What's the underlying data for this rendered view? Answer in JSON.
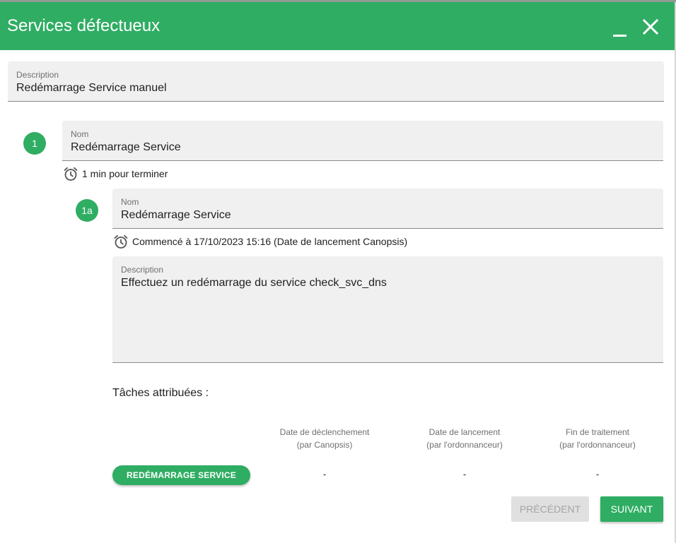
{
  "window": {
    "title": "Services défectueux",
    "minimize_icon": "minimize-icon",
    "close_icon": "close-icon"
  },
  "description_field": {
    "label": "Description",
    "value": "Redémarrage Service manuel"
  },
  "step": {
    "number": "1",
    "name_label": "Nom",
    "name_value": "Redémarrage Service",
    "duration_text": "1 min pour terminer",
    "duration_icon": "alarm-clock-icon"
  },
  "substep": {
    "number": "1a",
    "name_label": "Nom",
    "name_value": "Redémarrage Service",
    "started_text": "Commencé à 17/10/2023 15:16 (Date de lancement Canopsis)",
    "started_icon": "alarm-clock-icon",
    "description_label": "Description",
    "description_value": "Effectuez un redémarrage du service check_svc_dns"
  },
  "tasks": {
    "title": "Tâches attribuées :",
    "columns": [
      {
        "line1": "Date de déclenchement",
        "line2": "(par Canopsis)"
      },
      {
        "line1": "Date de lancement",
        "line2": "(par l'ordonnanceur)"
      },
      {
        "line1": "Fin de traitement",
        "line2": "(par l'ordonnanceur)"
      }
    ],
    "rows": [
      {
        "button_label": "REDÉMARRAGE SERVICE",
        "values": [
          "-",
          "-",
          "-"
        ]
      }
    ]
  },
  "footer": {
    "previous_label": "PRÉCÉDENT",
    "next_label": "SUIVANT"
  },
  "colors": {
    "accent": "#2fad63",
    "field_bg": "#f0f0f0",
    "disabled_bg": "#e0e0e0"
  }
}
